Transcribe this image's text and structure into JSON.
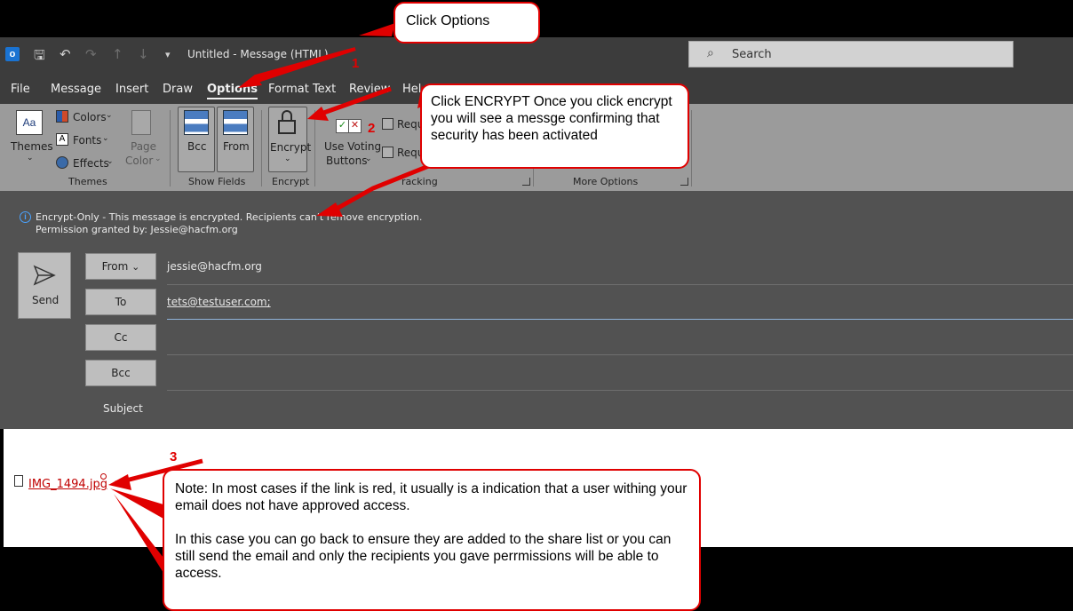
{
  "callouts": {
    "options": "Click Options",
    "encrypt": "Click ENCRYPT  Once you click encrypt you will see a messge confirming that security has been activated",
    "note_p1": "Note:  In most cases if the link is red, it usually is a indication that a user withing your email does not have approved access.",
    "note_p2": "In this case you can go back to ensure they are added to the share list or you can still send the email and only the recipients you gave perrmissions will be able to access."
  },
  "steps": [
    "1",
    "2",
    "3"
  ],
  "titlebar": {
    "title": "Untitled  -  Message (HTML)",
    "search_placeholder": "Search"
  },
  "menu": [
    "File",
    "Message",
    "Insert",
    "Draw",
    "Options",
    "Format Text",
    "Review",
    "Hel"
  ],
  "ribbon": {
    "themes": "Themes",
    "colors": "Colors",
    "fonts": "Fonts",
    "effects": "Effects",
    "page_color_1": "Page",
    "page_color_2": "Color",
    "bcc": "Bcc",
    "from": "From",
    "encrypt": "Encrypt",
    "voting_1": "Use Voting",
    "voting_2": "Buttons",
    "request_1": "Requ",
    "request_2": "Requ",
    "groups": {
      "themes": "Themes",
      "show_fields": "Show Fields",
      "encrypt": "Encrypt",
      "tracking": "racking",
      "more_options": "More Options"
    }
  },
  "infobar": {
    "line1": "Encrypt-Only - This message is encrypted. Recipients can't remove encryption.",
    "line2": "Permission granted by: Jessie@hacfm.org"
  },
  "compose": {
    "send": "Send",
    "from_label": "From",
    "from_value": "jessie@hacfm.org",
    "to_label": "To",
    "to_value": "tets@testuser.com;",
    "cc_label": "Cc",
    "bcc_label": "Bcc",
    "subject_label": "Subject"
  },
  "attachment": {
    "name": "IMG_1494.jpg"
  },
  "colors": {
    "callout_border": "#e00000",
    "link_red": "#c00000",
    "ribbon_bg": "#9b9b9b",
    "chrome_bg": "#3c3c3c"
  }
}
